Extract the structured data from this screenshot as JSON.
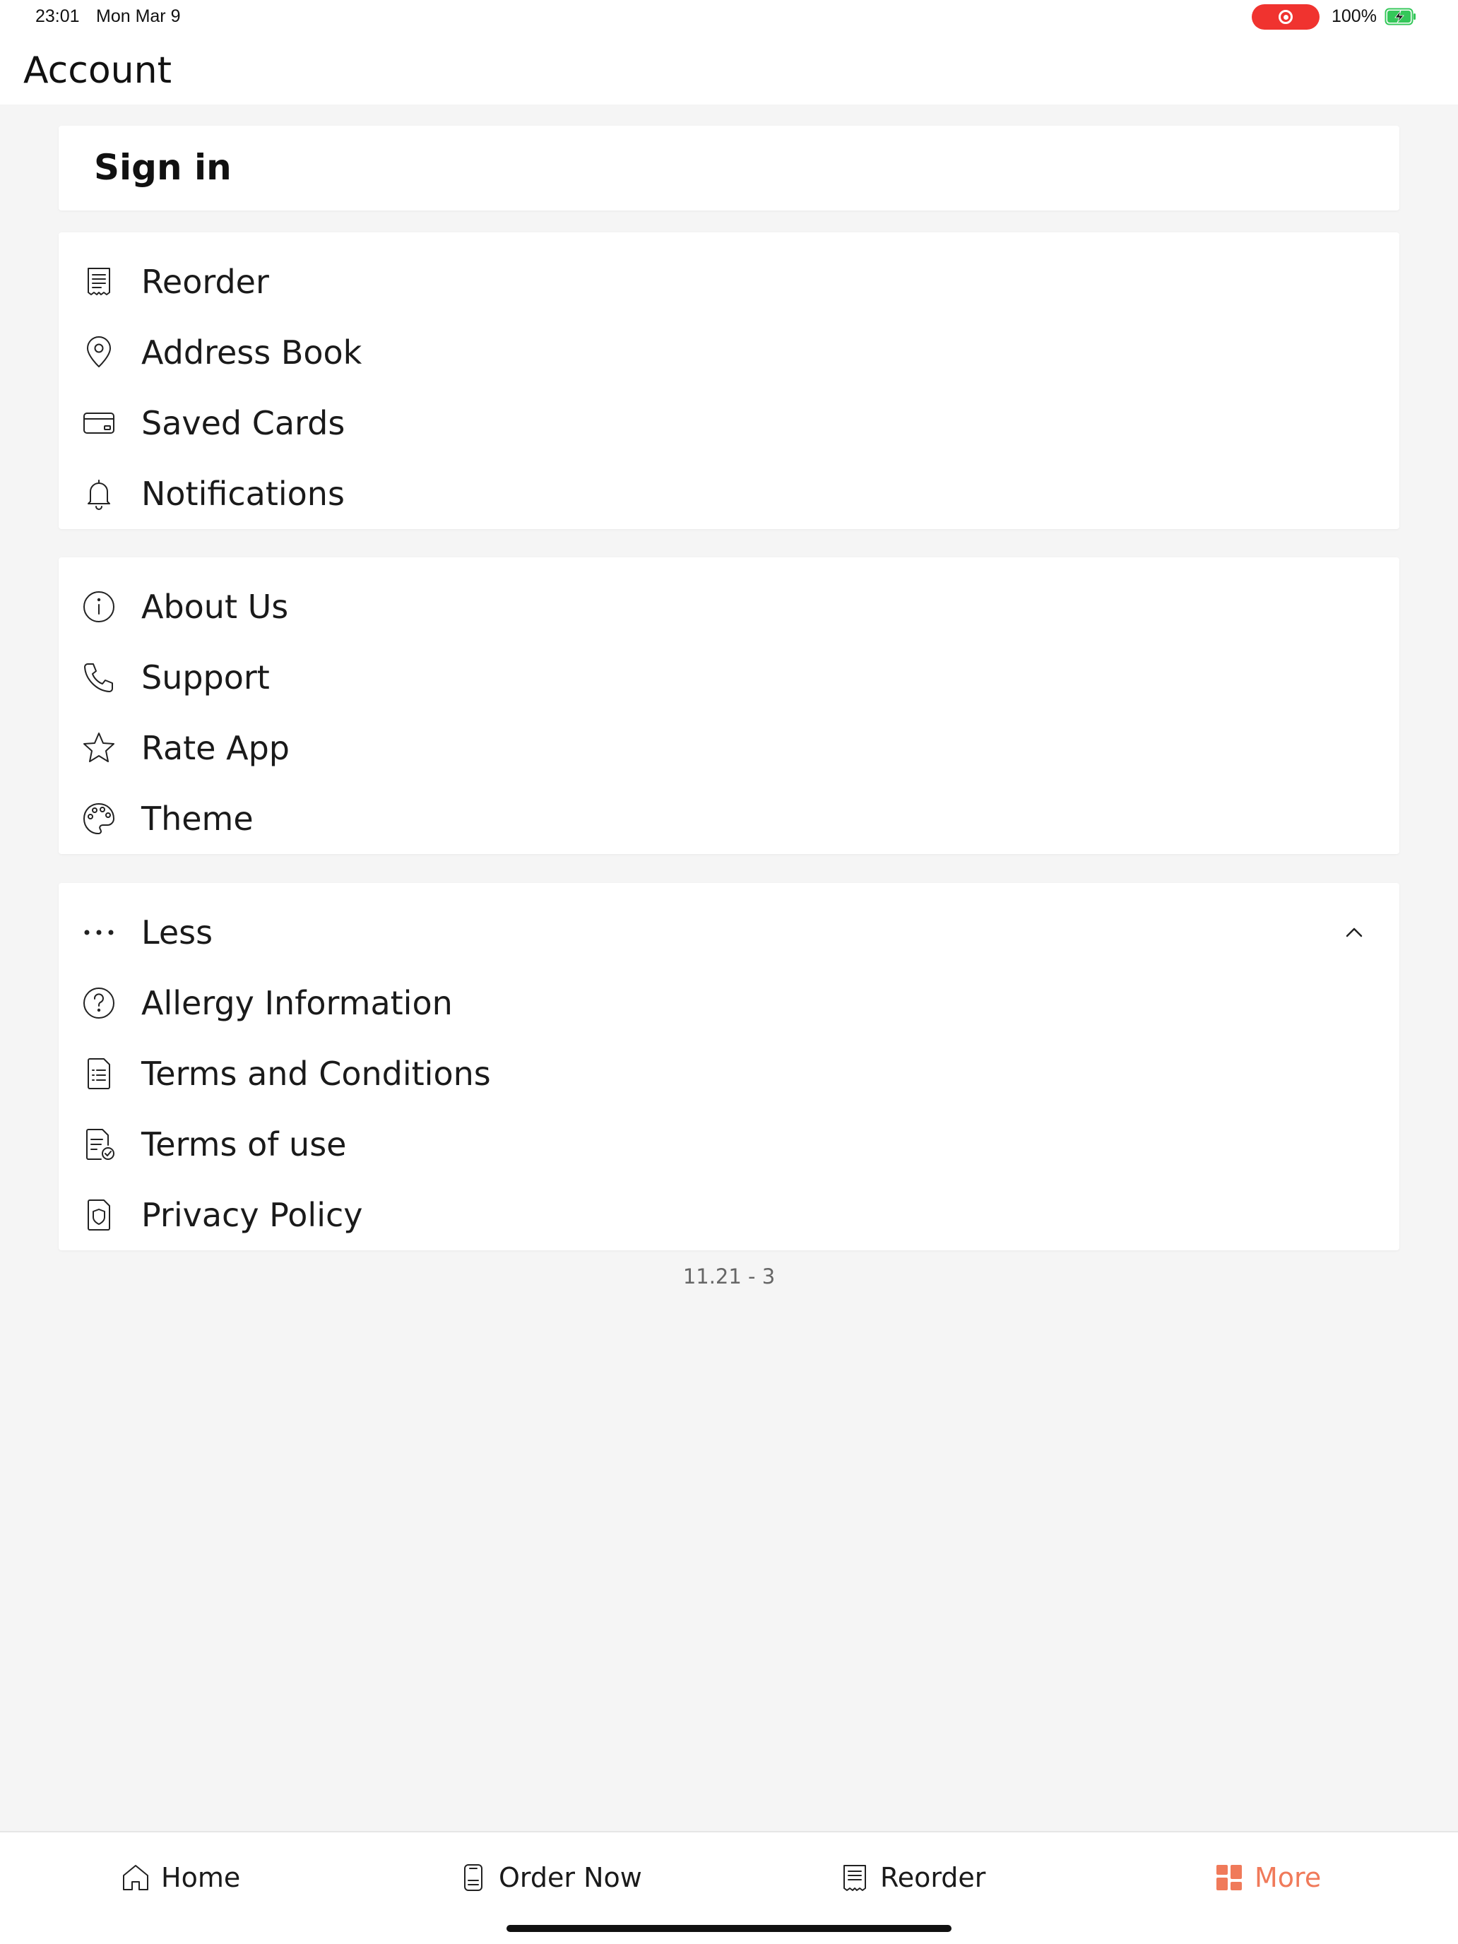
{
  "status_bar": {
    "time": "23:01",
    "date": "Mon Mar 9",
    "battery_pct": "100%",
    "recording_color": "#f0332f",
    "battery_color": "#34c759"
  },
  "header": {
    "title": "Account"
  },
  "signin": {
    "label": "Sign in"
  },
  "group_account": {
    "items": [
      {
        "label": "Reorder",
        "icon": "receipt-icon"
      },
      {
        "label": "Address Book",
        "icon": "location-pin-icon"
      },
      {
        "label": "Saved Cards",
        "icon": "credit-card-icon"
      },
      {
        "label": "Notifications",
        "icon": "bell-icon"
      }
    ]
  },
  "group_info": {
    "items": [
      {
        "label": "About Us",
        "icon": "info-icon"
      },
      {
        "label": "Support",
        "icon": "phone-icon"
      },
      {
        "label": "Rate App",
        "icon": "star-icon"
      },
      {
        "label": "Theme",
        "icon": "palette-icon"
      }
    ]
  },
  "group_more": {
    "toggle_label": "Less",
    "items": [
      {
        "label": "Allergy Information",
        "icon": "question-circle-icon"
      },
      {
        "label": "Terms and Conditions",
        "icon": "document-list-icon"
      },
      {
        "label": "Terms of use",
        "icon": "document-check-icon"
      },
      {
        "label": "Privacy Policy",
        "icon": "shield-document-icon"
      }
    ]
  },
  "version": "11.21 - 3",
  "tabbar": {
    "accent": "#f07a5a",
    "tabs": [
      {
        "label": "Home",
        "icon": "home-icon"
      },
      {
        "label": "Order Now",
        "icon": "order-icon"
      },
      {
        "label": "Reorder",
        "icon": "receipt-icon"
      },
      {
        "label": "More",
        "icon": "grid-icon",
        "active": true
      }
    ]
  }
}
